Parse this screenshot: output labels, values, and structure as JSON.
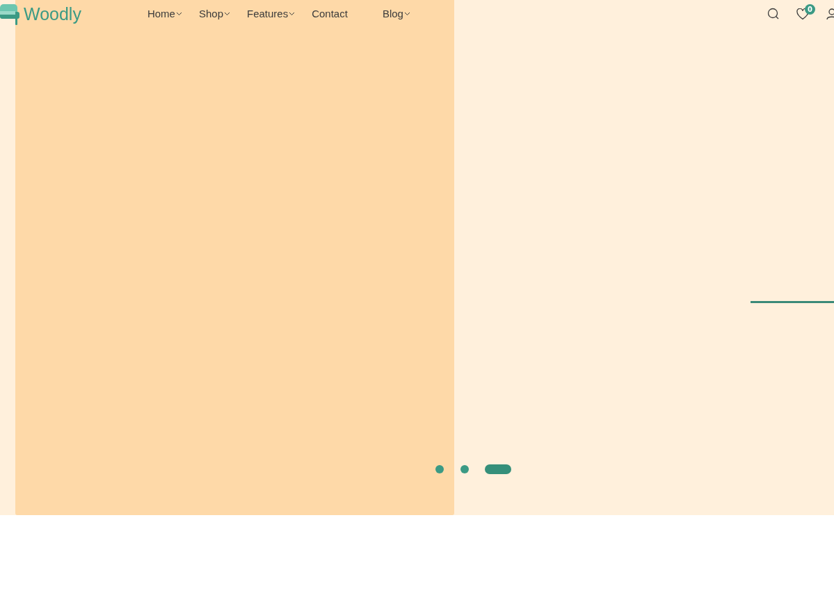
{
  "logo": {
    "text": "Woodly"
  },
  "nav": [
    {
      "label": "Home",
      "dropdown": true
    },
    {
      "label": "Shop",
      "dropdown": true
    },
    {
      "label": "Features",
      "dropdown": true
    },
    {
      "label": "Contact",
      "dropdown": false
    },
    {
      "label": "Blog",
      "dropdown": true
    }
  ],
  "wishlist": {
    "count": "0"
  },
  "slider_dots": [
    {
      "selected": false
    },
    {
      "selected": false
    },
    {
      "selected": true
    }
  ]
}
